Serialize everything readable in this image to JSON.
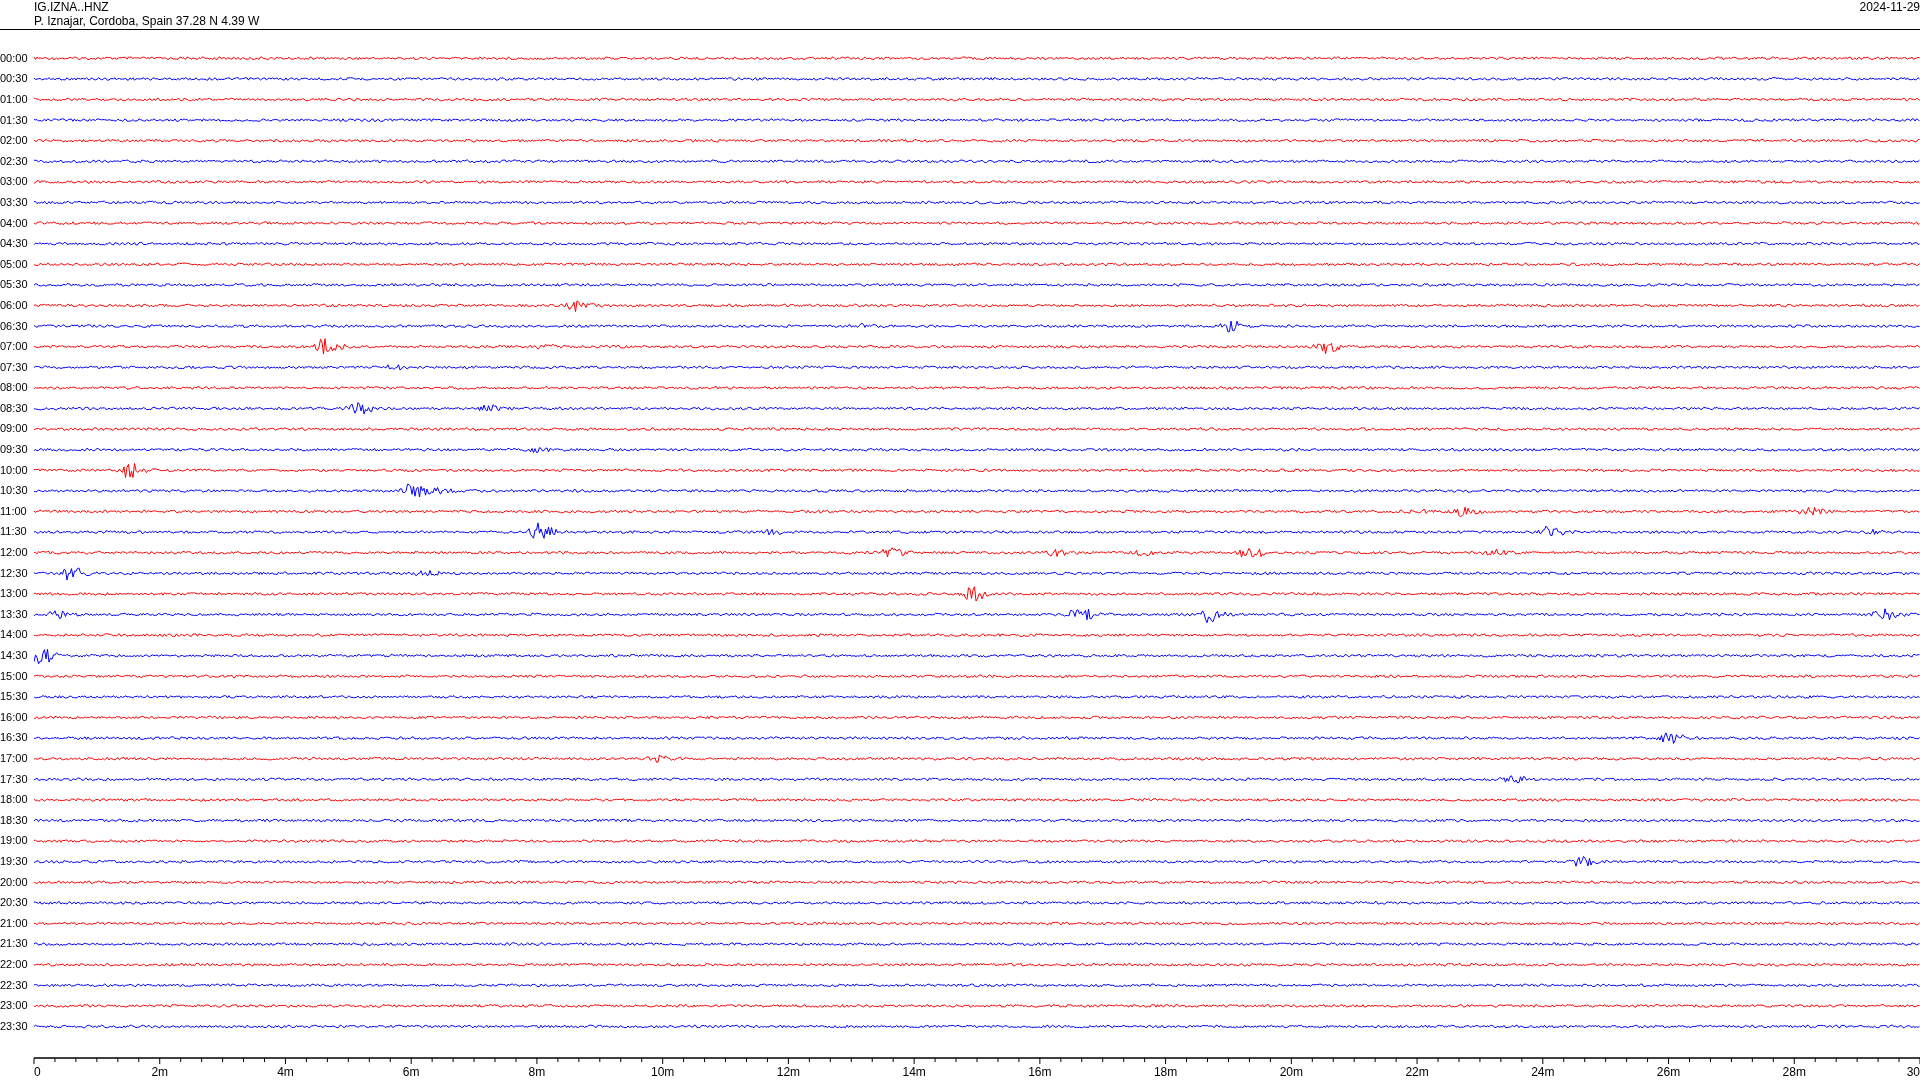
{
  "header": {
    "station": "IG.IZNA..HNZ",
    "location": "P. Iznajar, Cordoba, Spain  37.28 N 4.39 W",
    "date": "2024-11-29"
  },
  "rows": [
    {
      "label": "00:00",
      "color": "#ff0000"
    },
    {
      "label": "00:30",
      "color": "#0000ff"
    },
    {
      "label": "01:00",
      "color": "#ff0000"
    },
    {
      "label": "01:30",
      "color": "#0000ff"
    },
    {
      "label": "02:00",
      "color": "#ff0000"
    },
    {
      "label": "02:30",
      "color": "#0000ff"
    },
    {
      "label": "03:00",
      "color": "#ff0000"
    },
    {
      "label": "03:30",
      "color": "#0000ff"
    },
    {
      "label": "04:00",
      "color": "#ff0000"
    },
    {
      "label": "04:30",
      "color": "#0000ff"
    },
    {
      "label": "05:00",
      "color": "#ff0000"
    },
    {
      "label": "05:30",
      "color": "#0000ff"
    },
    {
      "label": "06:00",
      "color": "#ff0000"
    },
    {
      "label": "06:30",
      "color": "#0000ff"
    },
    {
      "label": "07:00",
      "color": "#ff0000"
    },
    {
      "label": "07:30",
      "color": "#0000ff"
    },
    {
      "label": "08:00",
      "color": "#ff0000"
    },
    {
      "label": "08:30",
      "color": "#0000ff"
    },
    {
      "label": "09:00",
      "color": "#ff0000"
    },
    {
      "label": "09:30",
      "color": "#0000ff"
    },
    {
      "label": "10:00",
      "color": "#ff0000"
    },
    {
      "label": "10:30",
      "color": "#0000ff"
    },
    {
      "label": "11:00",
      "color": "#ff0000"
    },
    {
      "label": "11:30",
      "color": "#0000ff"
    },
    {
      "label": "12:00",
      "color": "#ff0000"
    },
    {
      "label": "12:30",
      "color": "#0000ff"
    },
    {
      "label": "13:00",
      "color": "#ff0000"
    },
    {
      "label": "13:30",
      "color": "#0000ff"
    },
    {
      "label": "14:00",
      "color": "#ff0000"
    },
    {
      "label": "14:30",
      "color": "#0000ff"
    },
    {
      "label": "15:00",
      "color": "#ff0000"
    },
    {
      "label": "15:30",
      "color": "#0000ff"
    },
    {
      "label": "16:00",
      "color": "#ff0000"
    },
    {
      "label": "16:30",
      "color": "#0000ff"
    },
    {
      "label": "17:00",
      "color": "#ff0000"
    },
    {
      "label": "17:30",
      "color": "#0000ff"
    },
    {
      "label": "18:00",
      "color": "#ff0000"
    },
    {
      "label": "18:30",
      "color": "#0000ff"
    },
    {
      "label": "19:00",
      "color": "#ff0000"
    },
    {
      "label": "19:30",
      "color": "#0000ff"
    },
    {
      "label": "20:00",
      "color": "#ff0000"
    },
    {
      "label": "20:30",
      "color": "#0000ff"
    },
    {
      "label": "21:00",
      "color": "#ff0000"
    },
    {
      "label": "21:30",
      "color": "#0000ff"
    },
    {
      "label": "22:00",
      "color": "#ff0000"
    },
    {
      "label": "22:30",
      "color": "#0000ff"
    },
    {
      "label": "23:00",
      "color": "#ff0000"
    },
    {
      "label": "23:30",
      "color": "#0000ff"
    }
  ],
  "x_axis": {
    "labels": [
      "0",
      "2m",
      "4m",
      "6m",
      "8m",
      "10m",
      "12m",
      "14m",
      "16m",
      "18m",
      "20m",
      "22m",
      "24m",
      "26m",
      "28m",
      "30"
    ]
  }
}
